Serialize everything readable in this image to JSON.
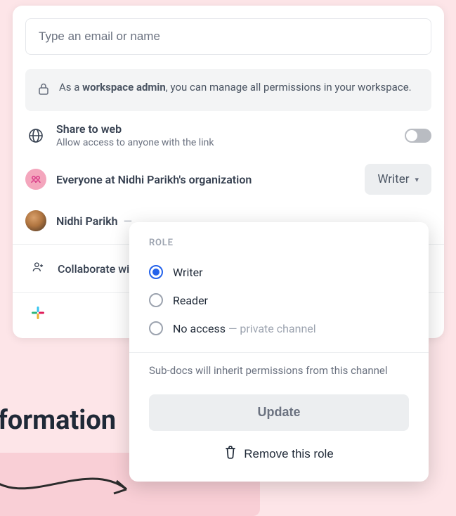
{
  "input": {
    "placeholder": "Type an email or name"
  },
  "adminNote": {
    "prefix": "As a ",
    "bold": "workspace admin",
    "suffix": ", you can manage all permissions in your workspace."
  },
  "shareWeb": {
    "title": "Share to web",
    "subtitle": "Allow access to anyone with the link"
  },
  "everyone": {
    "label": "Everyone at Nidhi Parikh's organization",
    "role": "Writer"
  },
  "user": {
    "name": "Nidhi Parikh",
    "dash": "—"
  },
  "collaborate": {
    "label": "Collaborate wit"
  },
  "rolePopover": {
    "heading": "ROLE",
    "options": [
      {
        "label": "Writer",
        "selected": true
      },
      {
        "label": "Reader",
        "selected": false
      },
      {
        "label": "No access",
        "suffix": " — private channel",
        "selected": false
      }
    ],
    "note": "Sub-docs will inherit permissions from this channel",
    "updateLabel": "Update",
    "removeLabel": "Remove this role"
  },
  "bgHeading": "al information"
}
